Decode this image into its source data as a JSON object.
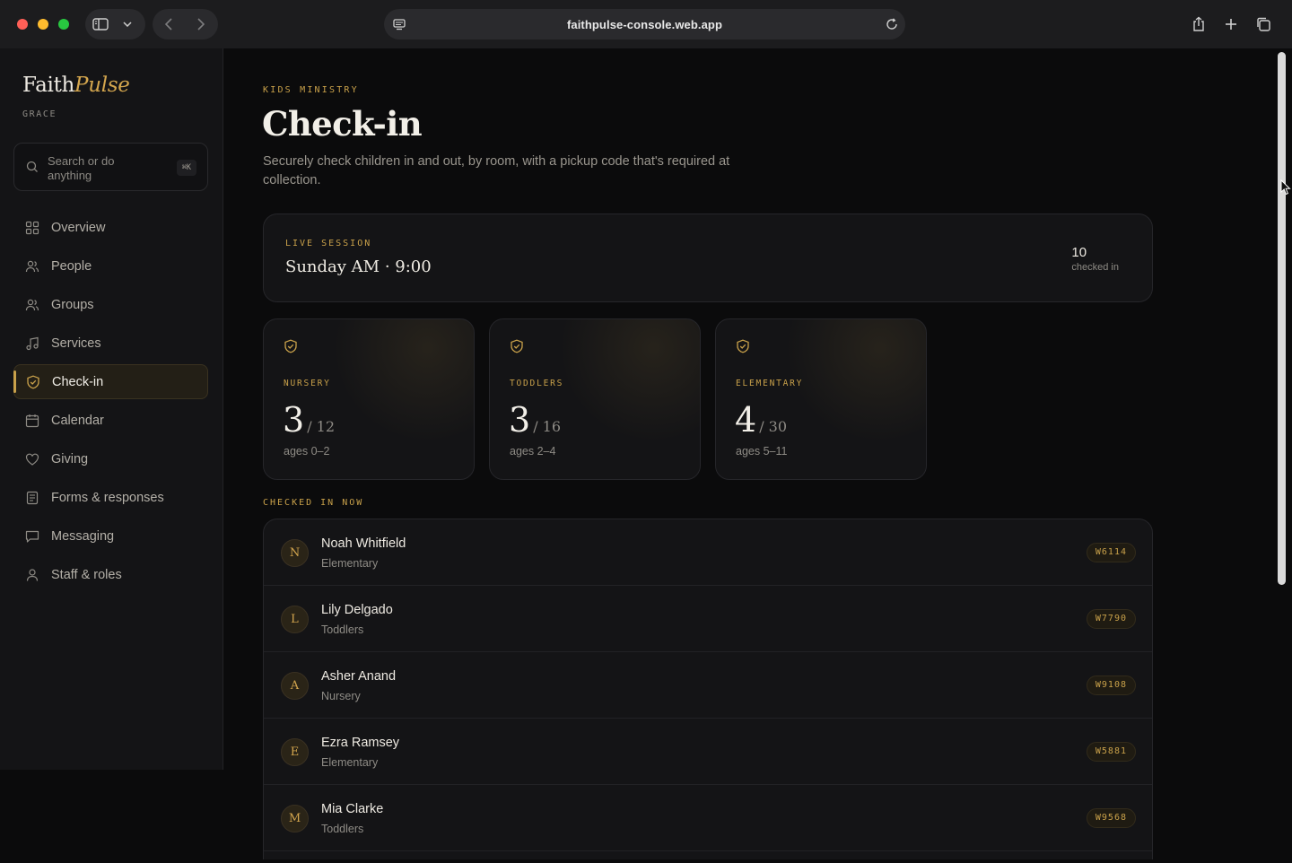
{
  "browser": {
    "url": "faithpulse-console.web.app"
  },
  "sidebar": {
    "brand_main": "Faith",
    "brand_accent": "Pulse",
    "org": "GRACE",
    "search_placeholder": "Search or do anything",
    "search_shortcut": "⌘K",
    "items": [
      {
        "label": "Overview",
        "icon": "grid-icon",
        "active": false
      },
      {
        "label": "People",
        "icon": "people-icon",
        "active": false
      },
      {
        "label": "Groups",
        "icon": "group-icon",
        "active": false
      },
      {
        "label": "Services",
        "icon": "music-note-icon",
        "active": false
      },
      {
        "label": "Check-in",
        "icon": "shield-check-icon",
        "active": true
      },
      {
        "label": "Calendar",
        "icon": "calendar-icon",
        "active": false
      },
      {
        "label": "Giving",
        "icon": "heart-icon",
        "active": false
      },
      {
        "label": "Forms & responses",
        "icon": "document-icon",
        "active": false
      },
      {
        "label": "Messaging",
        "icon": "message-icon",
        "active": false
      },
      {
        "label": "Staff & roles",
        "icon": "person-icon",
        "active": false
      }
    ]
  },
  "header": {
    "eyebrow": "KIDS MINISTRY",
    "title": "Check-in",
    "description": "Securely check children in and out, by room, with a pickup code that's required at collection."
  },
  "session": {
    "label": "LIVE SESSION",
    "name": "Sunday AM · 9:00",
    "count": "10",
    "count_caption": "checked in"
  },
  "rooms": [
    {
      "name": "NURSERY",
      "count": "3",
      "capacity": "/ 12",
      "ages": "ages 0–2"
    },
    {
      "name": "TODDLERS",
      "count": "3",
      "capacity": "/ 16",
      "ages": "ages 2–4"
    },
    {
      "name": "ELEMENTARY",
      "count": "4",
      "capacity": "/ 30",
      "ages": "ages 5–11"
    }
  ],
  "checked_in": {
    "label": "CHECKED IN NOW",
    "rows": [
      {
        "initial": "N",
        "name": "Noah Whitfield",
        "room": "Elementary",
        "code": "W6114"
      },
      {
        "initial": "L",
        "name": "Lily Delgado",
        "room": "Toddlers",
        "code": "W7790"
      },
      {
        "initial": "A",
        "name": "Asher Anand",
        "room": "Nursery",
        "code": "W9108"
      },
      {
        "initial": "E",
        "name": "Ezra Ramsey",
        "room": "Elementary",
        "code": "W5881"
      },
      {
        "initial": "M",
        "name": "Mia Clarke",
        "room": "Toddlers",
        "code": "W9568"
      }
    ]
  },
  "colors": {
    "accent": "#c9a14a",
    "background": "#0b0b0c",
    "panel": "#141416"
  }
}
